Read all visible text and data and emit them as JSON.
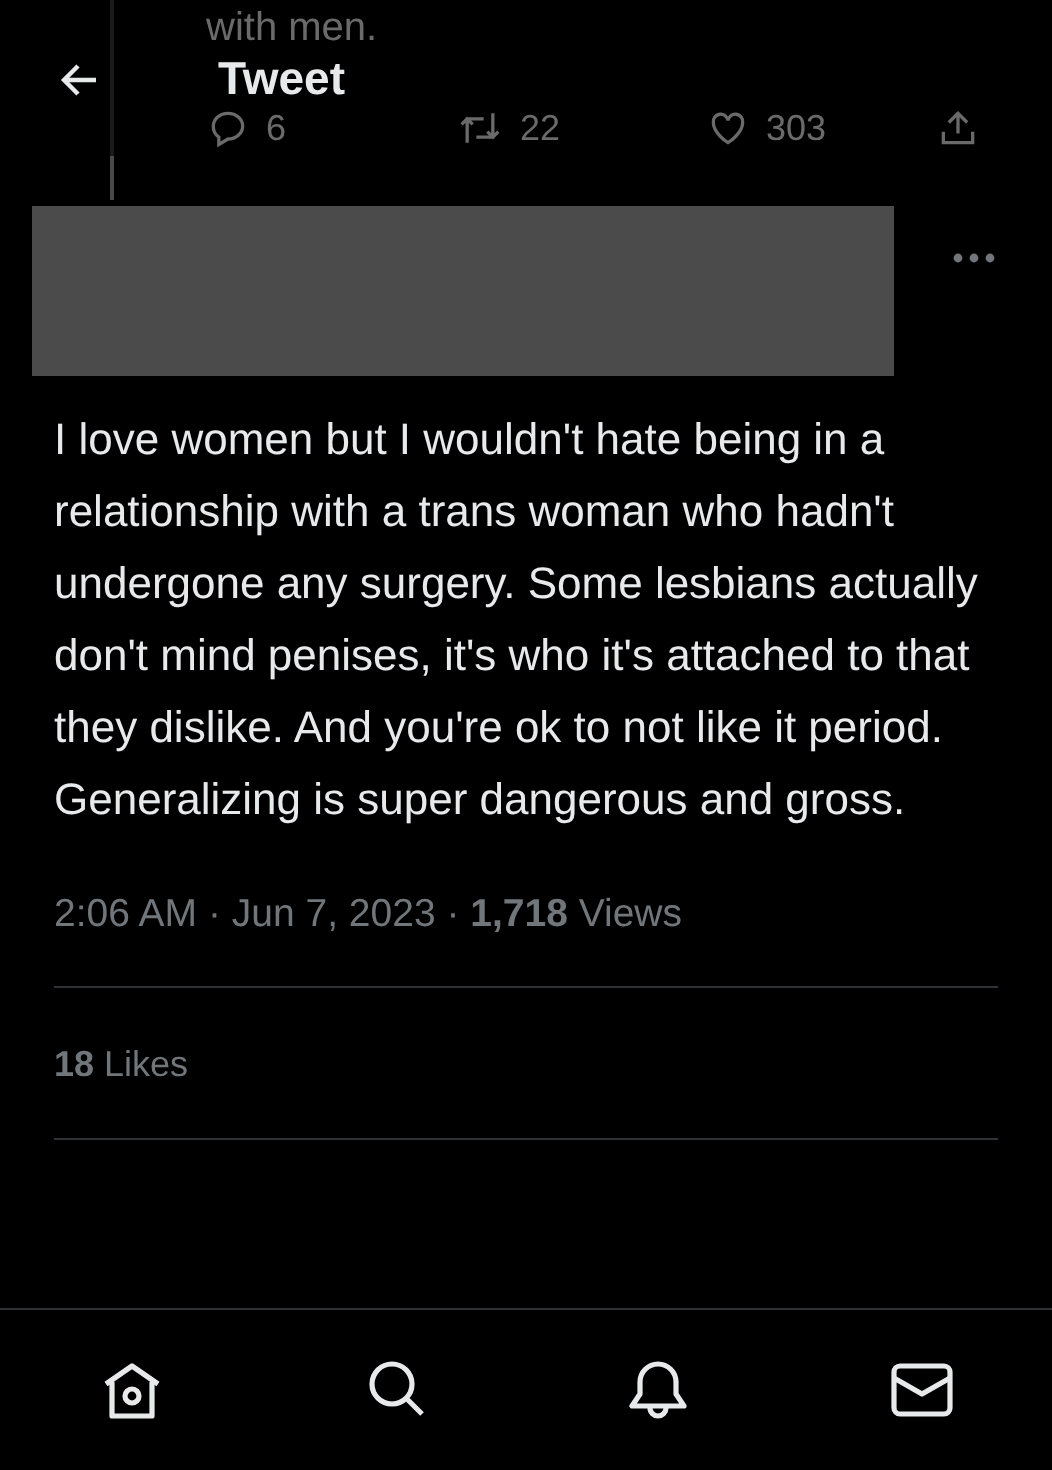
{
  "context_tweet": {
    "text": "with men.",
    "actions": [
      {
        "kind": "reply",
        "count": "6"
      },
      {
        "kind": "retweet",
        "count": "22"
      },
      {
        "kind": "like",
        "count": "303"
      },
      {
        "kind": "share"
      }
    ]
  },
  "header": {
    "title": "Tweet"
  },
  "tweet": {
    "author": {
      "kind": "redacted"
    },
    "text": "I love women but I wouldn't hate being in a relationship with a trans woman who hadn't undergone any surgery. Some lesbians actually don't mind penises, it's who it's attached to that they dislike. And you're ok to not like it period. Generalizing is super dangerous and gross.",
    "meta": "2:06 AM · Jun 7, 2023 · **1,718** Views",
    "likes": "**18** Likes"
  },
  "nav": [
    {
      "kind": "home"
    },
    {
      "kind": "search"
    },
    {
      "kind": "notifications"
    },
    {
      "kind": "messages"
    }
  ]
}
